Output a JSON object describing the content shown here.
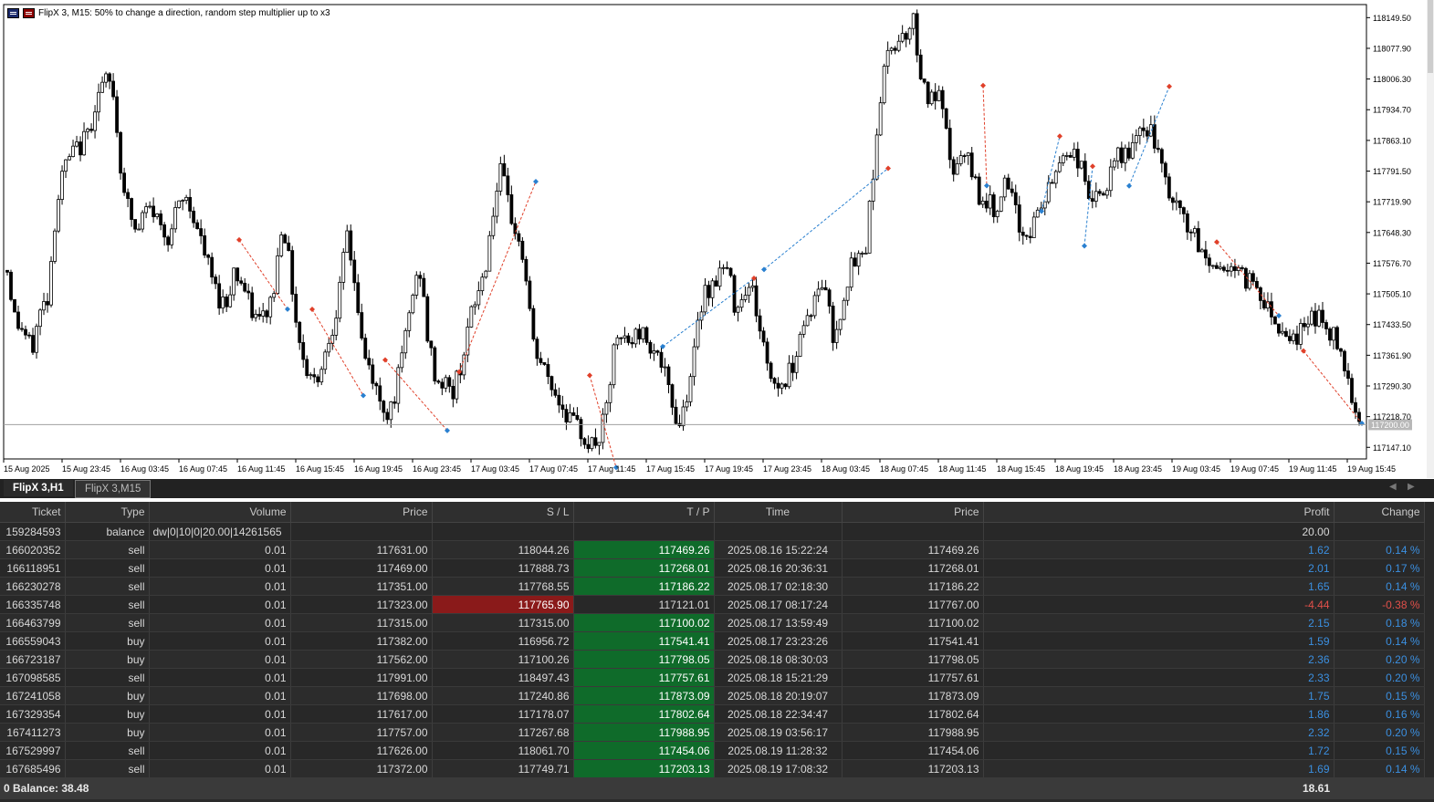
{
  "chart": {
    "symbol_title": "FlipX 3, M15:  50% to change a direction, random step multiplier up to x3",
    "current_price_label": "117200.00",
    "price_axis": [
      "118149.50",
      "118077.90",
      "118006.30",
      "117934.70",
      "117863.10",
      "117791.50",
      "117719.90",
      "117648.30",
      "117576.70",
      "117505.10",
      "117433.50",
      "117361.90",
      "117290.30",
      "117218.70",
      "117147.10"
    ],
    "time_axis": [
      "15 Aug 2025",
      "15 Aug 23:45",
      "16 Aug 03:45",
      "16 Aug 07:45",
      "16 Aug 11:45",
      "16 Aug 15:45",
      "16 Aug 19:45",
      "16 Aug 23:45",
      "17 Aug 03:45",
      "17 Aug 07:45",
      "17 Aug 11:45",
      "17 Aug 15:45",
      "17 Aug 19:45",
      "17 Aug 23:45",
      "18 Aug 03:45",
      "18 Aug 07:45",
      "18 Aug 11:45",
      "18 Aug 15:45",
      "18 Aug 19:45",
      "18 Aug 23:45",
      "19 Aug 03:45",
      "19 Aug 07:45",
      "19 Aug 11:45",
      "19 Aug 15:45"
    ],
    "colors": {
      "bull": "#ffffff",
      "bear": "#000000",
      "sell_line": "#e0402a",
      "buy_line": "#2a80d0"
    }
  },
  "chart_data": {
    "type": "candlestick",
    "ylim": [
      117120,
      118180
    ],
    "price_path": [
      117560,
      117440,
      117420,
      117370,
      117460,
      117500,
      117700,
      117800,
      117830,
      117850,
      117880,
      117960,
      118000,
      117990,
      117800,
      117700,
      117640,
      117700,
      117700,
      117660,
      117640,
      117700,
      117730,
      117690,
      117620,
      117560,
      117500,
      117480,
      117560,
      117530,
      117470,
      117440,
      117460,
      117520,
      117690,
      117550,
      117400,
      117330,
      117300,
      117350,
      117420,
      117500,
      117650,
      117520,
      117360,
      117320,
      117250,
      117230,
      117280,
      117380,
      117500,
      117560,
      117390,
      117300,
      117300,
      117270,
      117340,
      117430,
      117500,
      117560,
      117700,
      117790,
      117700,
      117640,
      117560,
      117380,
      117340,
      117300,
      117260,
      117230,
      117200,
      117180,
      117150,
      117160,
      117230,
      117380,
      117400,
      117390,
      117420,
      117400,
      117380,
      117330,
      117250,
      117200,
      117280,
      117380,
      117520,
      117520,
      117560,
      117560,
      117470,
      117520,
      117520,
      117420,
      117330,
      117290,
      117300,
      117340,
      117420,
      117460,
      117500,
      117540,
      117400,
      117470,
      117560,
      117580,
      117610,
      117800,
      117990,
      118080,
      118100,
      118120,
      118140,
      118000,
      117950,
      117970,
      117870,
      117780,
      117830,
      117800,
      117740,
      117720,
      117700,
      117760,
      117730,
      117660,
      117640,
      117680,
      117720,
      117760,
      117820,
      117840,
      117830,
      117780,
      117720,
      117730,
      117760,
      117820,
      117830,
      117850,
      117870,
      117900,
      117840,
      117760,
      117720,
      117690,
      117660,
      117620,
      117590,
      117570,
      117560,
      117580,
      117550,
      117540,
      117540,
      117500,
      117470,
      117430,
      117420,
      117400,
      117420,
      117460,
      117450,
      117420,
      117400,
      117360,
      117280,
      117210
    ],
    "sell_signals": [
      {
        "open_price": 117631.0,
        "close_price": 117469.26
      },
      {
        "open_price": 117469.0,
        "close_price": 117268.01
      },
      {
        "open_price": 117351.0,
        "close_price": 117186.22
      },
      {
        "open_price": 117323.0,
        "close_price": 117767.0
      },
      {
        "open_price": 117315.0,
        "close_price": 117100.02
      },
      {
        "open_price": 117991.0,
        "close_price": 117757.61
      },
      {
        "open_price": 117626.0,
        "close_price": 117454.06
      },
      {
        "open_price": 117372.0,
        "close_price": 117203.13
      }
    ],
    "buy_signals": [
      {
        "open_price": 117382.0,
        "close_price": 117541.41
      },
      {
        "open_price": 117562.0,
        "close_price": 117798.05
      },
      {
        "open_price": 117698.0,
        "close_price": 117873.09
      },
      {
        "open_price": 117617.0,
        "close_price": 117802.64
      },
      {
        "open_price": 117757.0,
        "close_price": 117988.95
      }
    ]
  },
  "tabs": [
    {
      "label": "FlipX 3,H1"
    },
    {
      "label": "FlipX 3,M15"
    }
  ],
  "table": {
    "headers": [
      "Ticket",
      "Type",
      "Volume",
      "Price",
      "S / L",
      "T / P",
      "Time",
      "Price",
      "Profit",
      "Change"
    ],
    "rows": [
      {
        "ticket": "159284593",
        "type": "balance",
        "volume": "dw|0|10|0|20.00|14261565",
        "price": "",
        "sl": "",
        "tp": "",
        "time": "",
        "price2": "",
        "profit": "20.00",
        "change": ""
      },
      {
        "ticket": "166020352",
        "type": "sell",
        "volume": "0.01",
        "price": "117631.00",
        "sl": "118044.26",
        "tp": "117469.26",
        "time": "2025.08.16 15:22:24",
        "price2": "117469.26",
        "profit": "1.62",
        "change": "0.14 %"
      },
      {
        "ticket": "166118951",
        "type": "sell",
        "volume": "0.01",
        "price": "117469.00",
        "sl": "117888.73",
        "tp": "117268.01",
        "time": "2025.08.16 20:36:31",
        "price2": "117268.01",
        "profit": "2.01",
        "change": "0.17 %"
      },
      {
        "ticket": "166230278",
        "type": "sell",
        "volume": "0.01",
        "price": "117351.00",
        "sl": "117768.55",
        "tp": "117186.22",
        "time": "2025.08.17 02:18:30",
        "price2": "117186.22",
        "profit": "1.65",
        "change": "0.14 %"
      },
      {
        "ticket": "166335748",
        "type": "sell",
        "volume": "0.01",
        "price": "117323.00",
        "sl": "117765.90",
        "tp": "117121.01",
        "time": "2025.08.17 08:17:24",
        "price2": "117767.00",
        "profit": "-4.44",
        "change": "-0.38 %"
      },
      {
        "ticket": "166463799",
        "type": "sell",
        "volume": "0.01",
        "price": "117315.00",
        "sl": "117315.00",
        "tp": "117100.02",
        "time": "2025.08.17 13:59:49",
        "price2": "117100.02",
        "profit": "2.15",
        "change": "0.18 %"
      },
      {
        "ticket": "166559043",
        "type": "buy",
        "volume": "0.01",
        "price": "117382.00",
        "sl": "116956.72",
        "tp": "117541.41",
        "time": "2025.08.17 23:23:26",
        "price2": "117541.41",
        "profit": "1.59",
        "change": "0.14 %"
      },
      {
        "ticket": "166723187",
        "type": "buy",
        "volume": "0.01",
        "price": "117562.00",
        "sl": "117100.26",
        "tp": "117798.05",
        "time": "2025.08.18 08:30:03",
        "price2": "117798.05",
        "profit": "2.36",
        "change": "0.20 %"
      },
      {
        "ticket": "167098585",
        "type": "sell",
        "volume": "0.01",
        "price": "117991.00",
        "sl": "118497.43",
        "tp": "117757.61",
        "time": "2025.08.18 15:21:29",
        "price2": "117757.61",
        "profit": "2.33",
        "change": "0.20 %"
      },
      {
        "ticket": "167241058",
        "type": "buy",
        "volume": "0.01",
        "price": "117698.00",
        "sl": "117240.86",
        "tp": "117873.09",
        "time": "2025.08.18 20:19:07",
        "price2": "117873.09",
        "profit": "1.75",
        "change": "0.15 %"
      },
      {
        "ticket": "167329354",
        "type": "buy",
        "volume": "0.01",
        "price": "117617.00",
        "sl": "117178.07",
        "tp": "117802.64",
        "time": "2025.08.18 22:34:47",
        "price2": "117802.64",
        "profit": "1.86",
        "change": "0.16 %"
      },
      {
        "ticket": "167411273",
        "type": "buy",
        "volume": "0.01",
        "price": "117757.00",
        "sl": "117267.68",
        "tp": "117988.95",
        "time": "2025.08.19 03:56:17",
        "price2": "117988.95",
        "profit": "2.32",
        "change": "0.20 %"
      },
      {
        "ticket": "167529997",
        "type": "sell",
        "volume": "0.01",
        "price": "117626.00",
        "sl": "118061.70",
        "tp": "117454.06",
        "time": "2025.08.19 11:28:32",
        "price2": "117454.06",
        "profit": "1.72",
        "change": "0.15 %"
      },
      {
        "ticket": "167685496",
        "type": "sell",
        "volume": "0.01",
        "price": "117372.00",
        "sl": "117749.71",
        "tp": "117203.13",
        "time": "2025.08.19 17:08:32",
        "price2": "117203.13",
        "profit": "1.69",
        "change": "0.14 %"
      }
    ]
  },
  "footer": {
    "balance": "0  Balance: 38.48",
    "total_profit": "18.61"
  }
}
